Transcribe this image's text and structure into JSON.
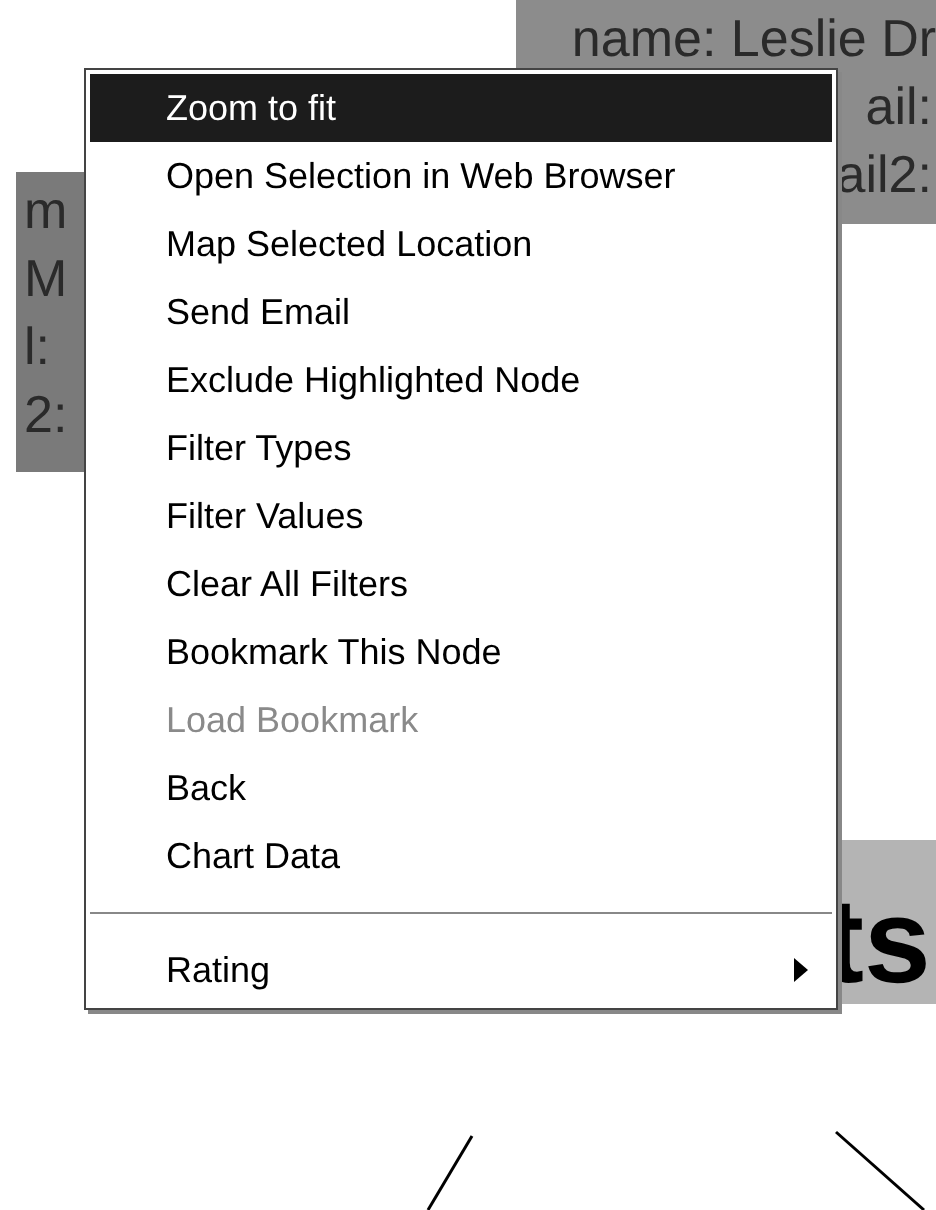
{
  "nodes": [
    {
      "kind": "card",
      "lines": [
        "name: Leslie Dr",
        "ail:",
        "ail2:"
      ]
    },
    {
      "kind": "card",
      "lines": [
        "m",
        "M",
        "l:",
        "2:"
      ]
    },
    {
      "kind": "title",
      "lines": [
        "ts"
      ]
    }
  ],
  "context_menu": {
    "items": [
      {
        "kind": "item",
        "label": "Zoom to fit",
        "selected": true,
        "disabled": false
      },
      {
        "kind": "item",
        "label": "Open Selection in Web Browser",
        "selected": false,
        "disabled": false
      },
      {
        "kind": "item",
        "label": "Map Selected Location",
        "selected": false,
        "disabled": false
      },
      {
        "kind": "item",
        "label": "Send Email",
        "selected": false,
        "disabled": false
      },
      {
        "kind": "item",
        "label": "Exclude Highlighted Node",
        "selected": false,
        "disabled": false
      },
      {
        "kind": "item",
        "label": "Filter Types",
        "selected": false,
        "disabled": false
      },
      {
        "kind": "item",
        "label": "Filter Values",
        "selected": false,
        "disabled": false
      },
      {
        "kind": "item",
        "label": "Clear All Filters",
        "selected": false,
        "disabled": false
      },
      {
        "kind": "item",
        "label": "Bookmark This Node",
        "selected": false,
        "disabled": false
      },
      {
        "kind": "item",
        "label": "Load Bookmark",
        "selected": false,
        "disabled": true
      },
      {
        "kind": "item",
        "label": "Back",
        "selected": false,
        "disabled": false
      },
      {
        "kind": "item",
        "label": "Chart Data",
        "selected": false,
        "disabled": false
      },
      {
        "kind": "separator"
      },
      {
        "kind": "submenu",
        "label": "Rating",
        "selected": false,
        "disabled": false
      }
    ]
  }
}
